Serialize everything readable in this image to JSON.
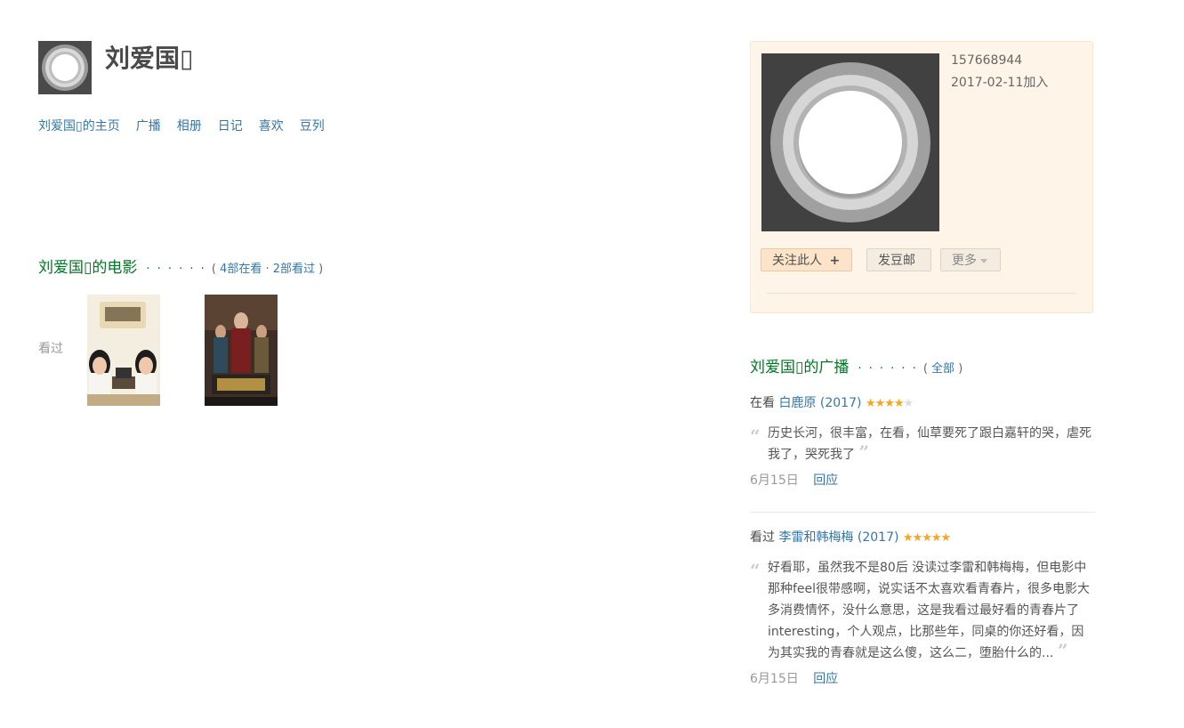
{
  "user": {
    "name": "刘爱国▯",
    "id": "157668944",
    "joined": "2017-02-11加入"
  },
  "nav": [
    {
      "label": "刘爱国▯的主页"
    },
    {
      "label": "广播"
    },
    {
      "label": "相册"
    },
    {
      "label": "日记"
    },
    {
      "label": "喜欢"
    },
    {
      "label": "豆列"
    }
  ],
  "movies": {
    "title": "刘爱国▯的电影",
    "dots": "· · · · · ·",
    "open_paren": "( ",
    "watching": "4部在看",
    "sep": " · ",
    "watched": "2部看过",
    "close_paren": " )",
    "seen_label": "看过"
  },
  "buttons": {
    "follow": "关注此人",
    "follow_icon": "+",
    "mail": "发豆邮",
    "more": "更多"
  },
  "broadcast": {
    "title": "刘爱国▯的广播",
    "dots": "· · · · · ·",
    "open_paren": "( ",
    "all": "全部",
    "close_paren": " )",
    "items": [
      {
        "verb": "在看",
        "title": "白鹿原",
        "year": "(2017)",
        "rating": 4,
        "quote": "历史长河，很丰富，在看，仙草要死了跟白嘉轩的哭，虐死我了，哭死我了",
        "date": "6月15日",
        "reply": "回应"
      },
      {
        "verb": "看过",
        "title": "李雷和韩梅梅",
        "year": "(2017)",
        "rating": 5,
        "quote": "好看耶，虽然我不是80后 没读过李雷和韩梅梅，但电影中那种feel很带感啊，说实话不太喜欢看青春片，很多电影大多消费情怀，没什么意思，这是我看过最好看的青春片了 interesting，个人观点，比那些年，同桌的你还好看，因为其实我的青春就是这么傻，这么二，堕胎什么的...",
        "date": "6月15日",
        "reply": "回应"
      }
    ]
  },
  "colors": {
    "link": "#3377aa",
    "section_title": "#007722",
    "star": "#f5a623",
    "card_bg": "#fff4e8"
  }
}
